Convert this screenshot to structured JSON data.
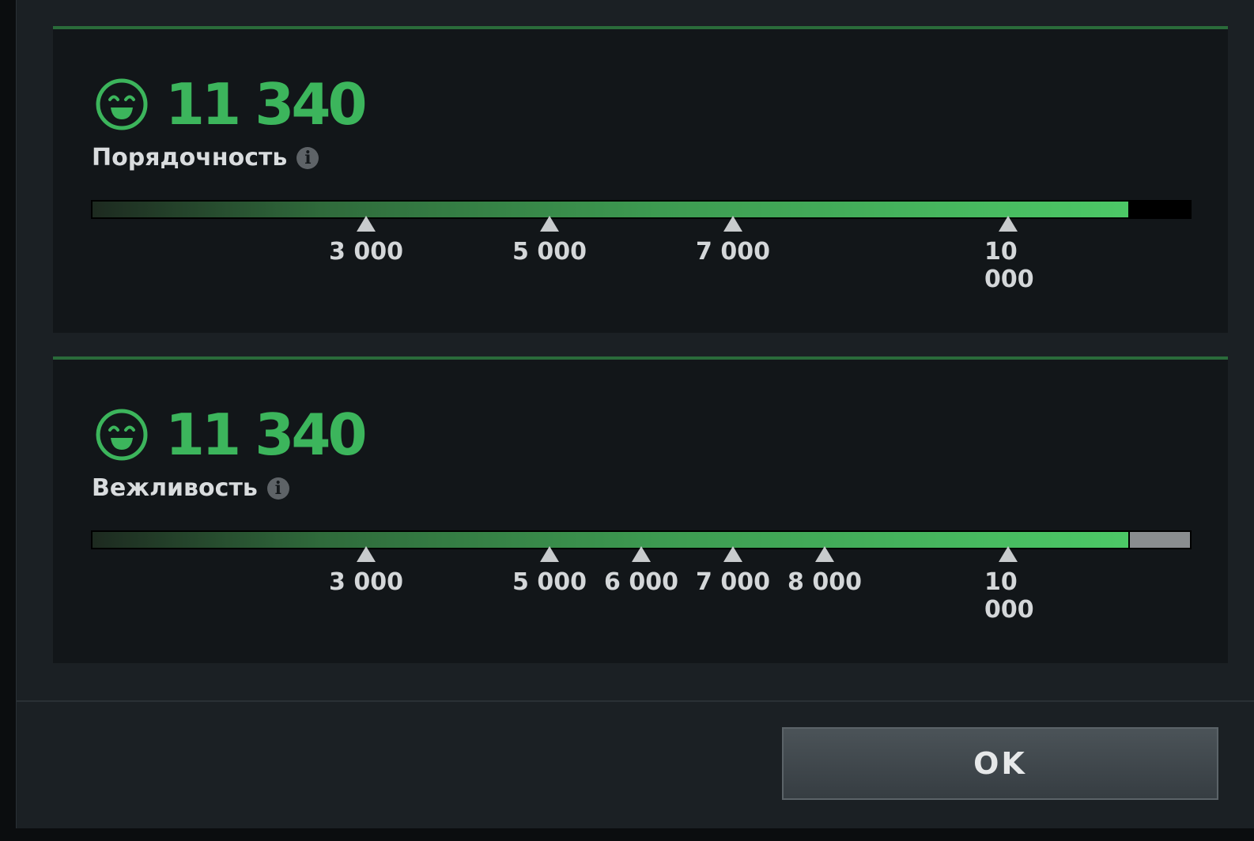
{
  "panels": [
    {
      "score": "11 340",
      "title": "Порядочность",
      "info_symbol": "i",
      "progress": 0.944,
      "remainder_color": "#000000",
      "markers": [
        {
          "value": 3000,
          "label": "3 000",
          "wrap": false
        },
        {
          "value": 5000,
          "label": "5 000",
          "wrap": false
        },
        {
          "value": 7000,
          "label": "7 000",
          "wrap": false
        },
        {
          "value": 10000,
          "label": "10 000",
          "wrap": true
        }
      ]
    },
    {
      "score": "11 340",
      "title": "Вежливость",
      "info_symbol": "i",
      "progress": 0.944,
      "remainder_color": "#8a8d8f",
      "markers": [
        {
          "value": 3000,
          "label": "3 000",
          "wrap": false
        },
        {
          "value": 5000,
          "label": "5 000",
          "wrap": false
        },
        {
          "value": 6000,
          "label": "6 000",
          "wrap": false
        },
        {
          "value": 7000,
          "label": "7 000",
          "wrap": false
        },
        {
          "value": 8000,
          "label": "8 000",
          "wrap": false
        },
        {
          "value": 10000,
          "label": "10 000",
          "wrap": true
        }
      ]
    }
  ],
  "footer": {
    "ok_label": "OK"
  },
  "colors": {
    "accent": "#3cb55c",
    "panel_border": "#2a6b3a"
  },
  "icons": {
    "score_icon": "smiley-face-icon",
    "info_icon": "info-icon"
  }
}
